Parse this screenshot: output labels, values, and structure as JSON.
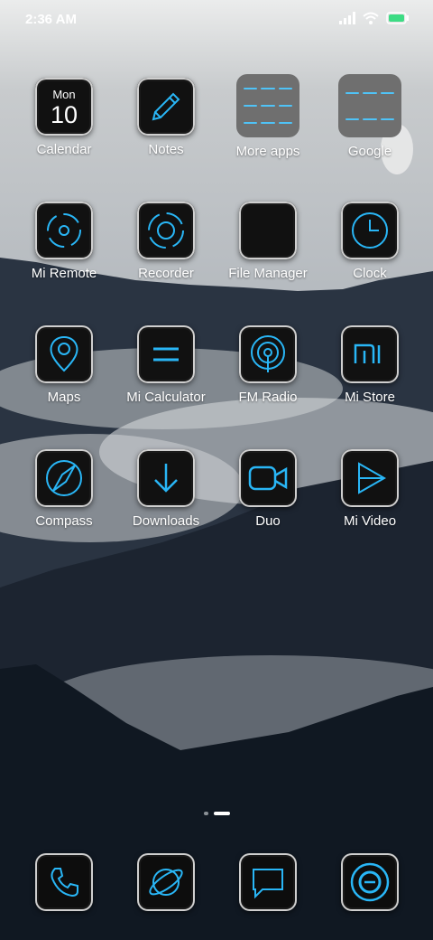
{
  "status": {
    "time": "2:36 AM"
  },
  "apps": [
    {
      "label": "Calendar",
      "icon": "calendar-icon"
    },
    {
      "label": "Notes",
      "icon": "notes-icon"
    },
    {
      "label": "More apps",
      "icon": "folder-icon"
    },
    {
      "label": "Google",
      "icon": "folder-icon"
    },
    {
      "label": "Mi Remote",
      "icon": "remote-icon"
    },
    {
      "label": "Recorder",
      "icon": "recorder-icon"
    },
    {
      "label": "File Manager",
      "icon": "file-manager-icon"
    },
    {
      "label": "Clock",
      "icon": "clock-icon"
    },
    {
      "label": "Maps",
      "icon": "maps-icon"
    },
    {
      "label": "Mi Calculator",
      "icon": "calculator-icon"
    },
    {
      "label": "FM Radio",
      "icon": "radio-icon"
    },
    {
      "label": "Mi Store",
      "icon": "mi-store-icon"
    },
    {
      "label": "Compass",
      "icon": "compass-icon"
    },
    {
      "label": "Downloads",
      "icon": "download-icon"
    },
    {
      "label": "Duo",
      "icon": "video-camera-icon"
    },
    {
      "label": "Mi Video",
      "icon": "play-icon"
    }
  ],
  "calendar_icon": {
    "day_name": "Mon",
    "day_number": "10"
  },
  "dock": [
    {
      "icon": "phone-icon"
    },
    {
      "icon": "browser-icon"
    },
    {
      "icon": "messages-icon"
    },
    {
      "icon": "camera-icon"
    }
  ],
  "pages": {
    "count": 2,
    "active": 2
  },
  "colors": {
    "accent": "#29b6f6",
    "icon_bg": "#111111",
    "label": "#ffffff"
  }
}
